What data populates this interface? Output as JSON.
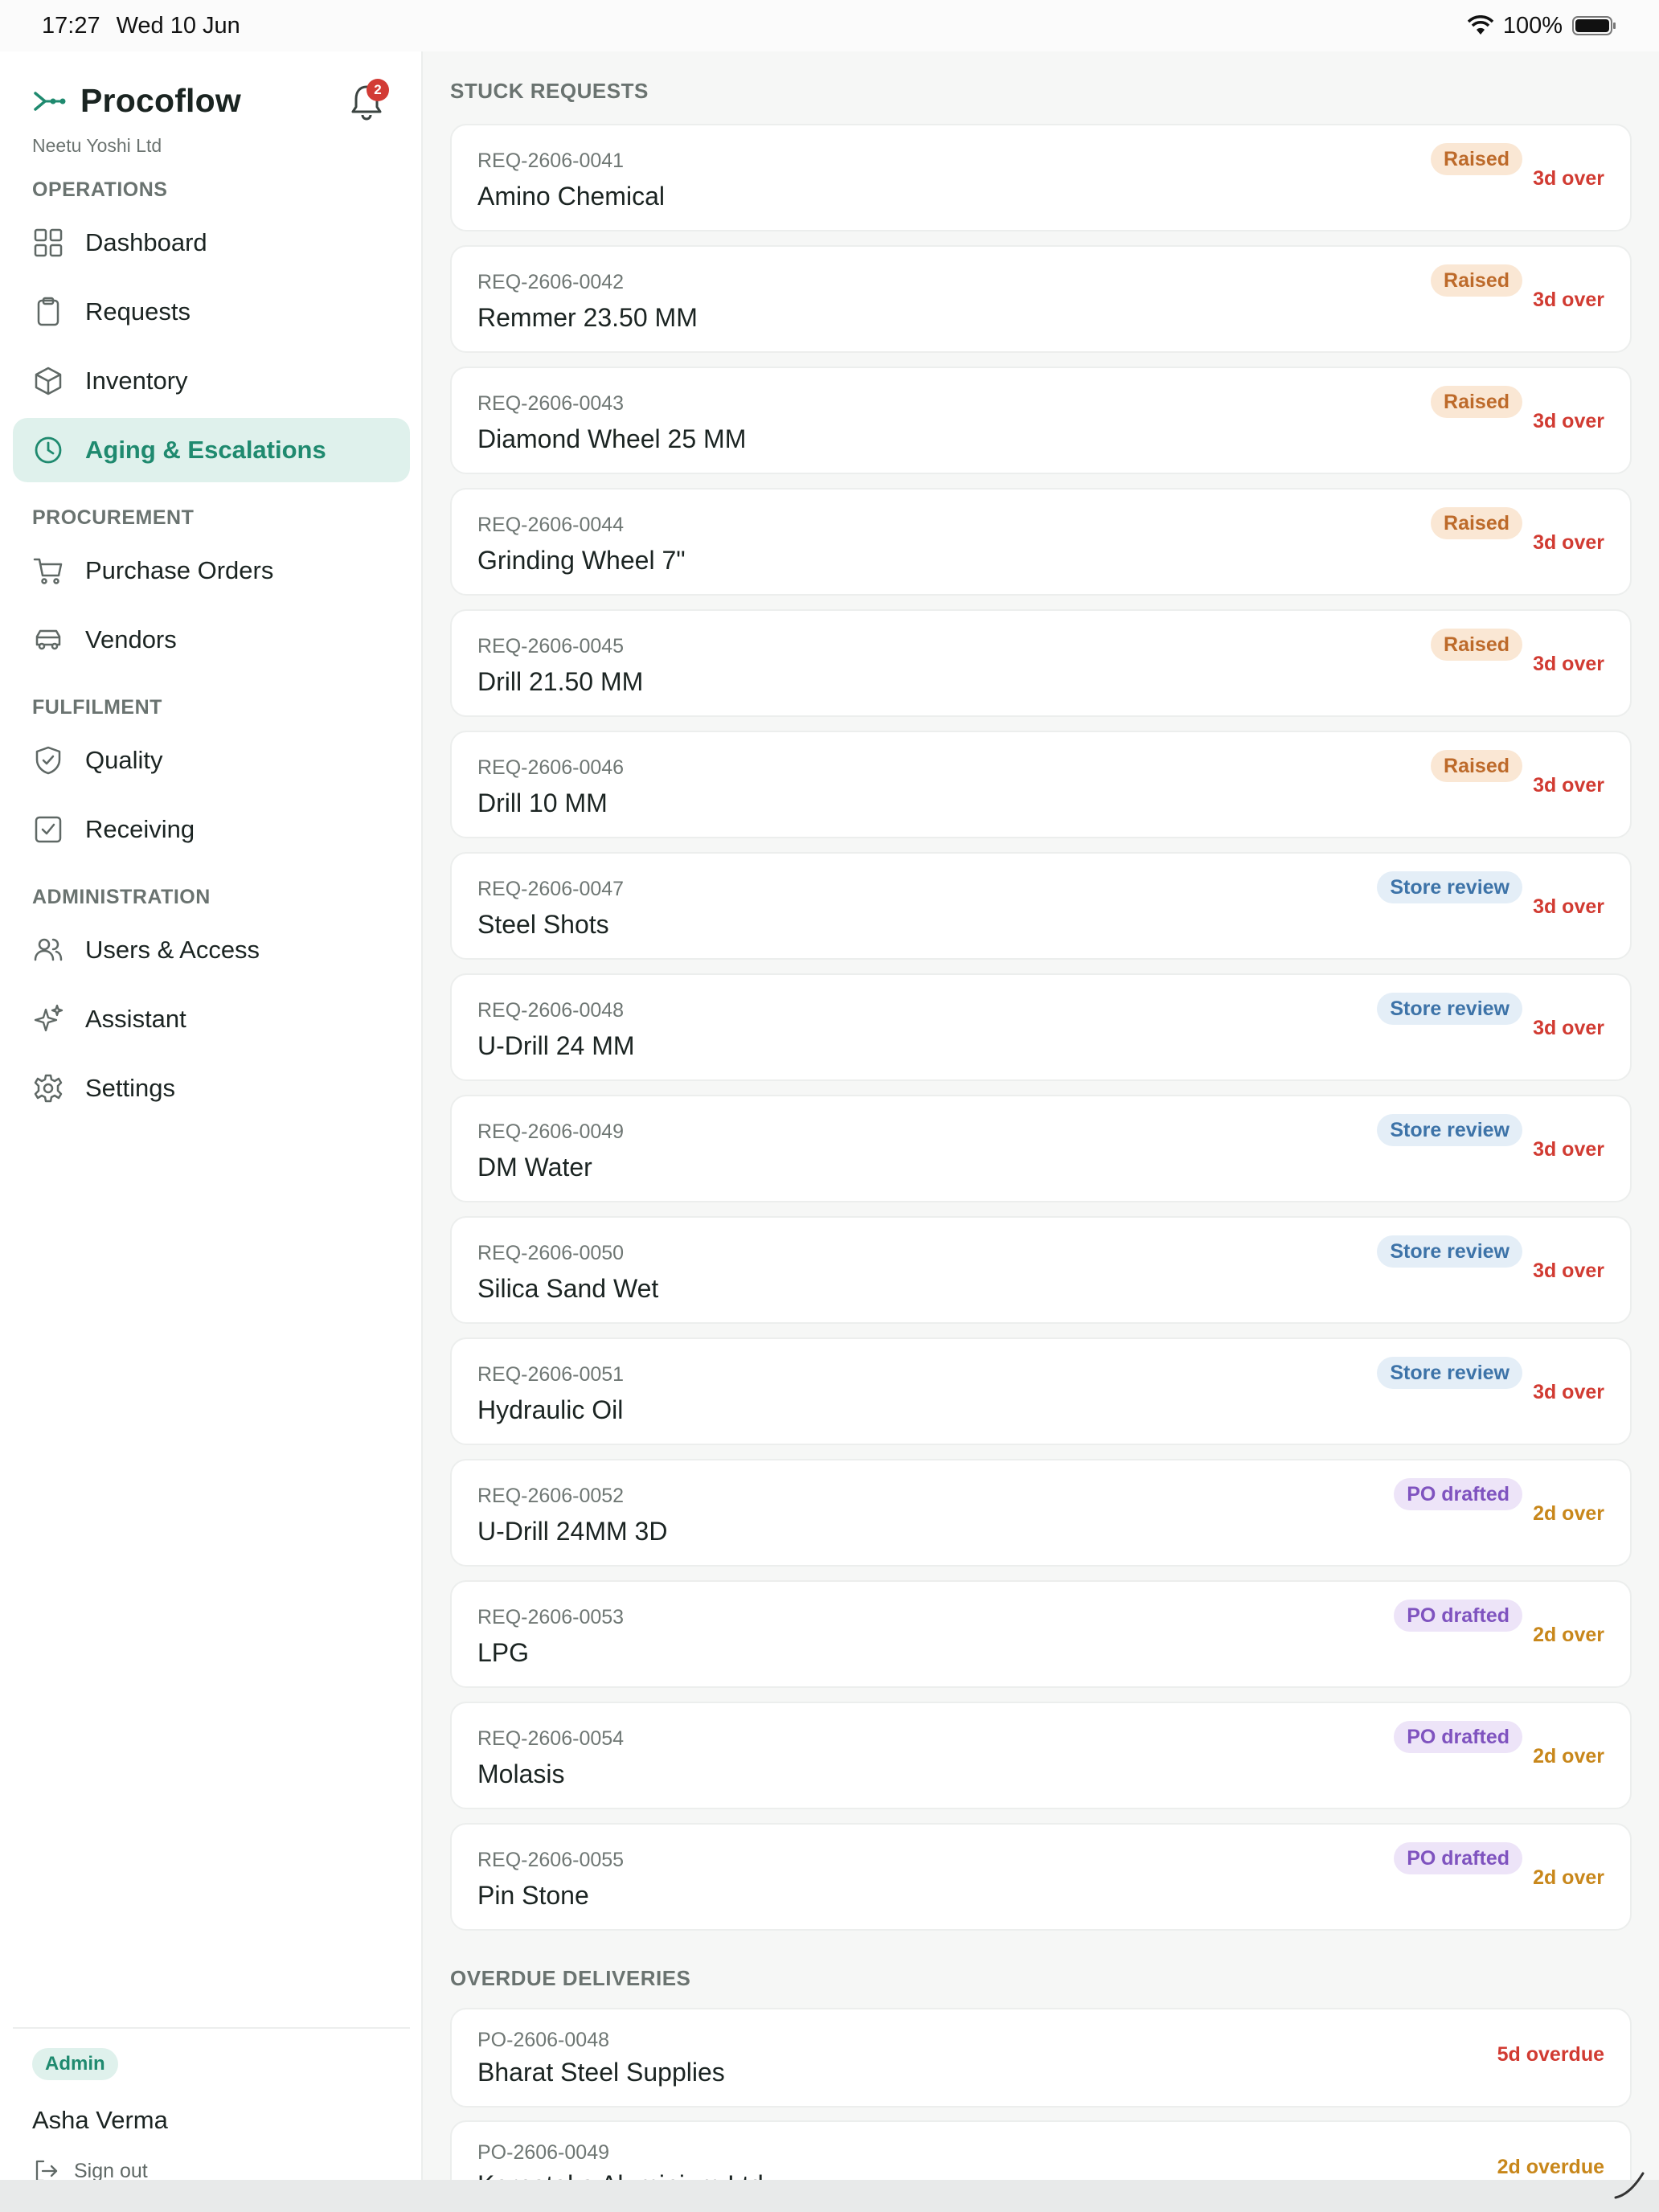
{
  "status_bar": {
    "time": "17:27",
    "date": "Wed 10 Jun",
    "battery": "100%"
  },
  "sidebar": {
    "app_name": "Procoflow",
    "org_name": "Neetu Yoshi Ltd",
    "notification_count": "2",
    "sections": [
      {
        "label": "OPERATIONS",
        "items": [
          {
            "label": "Dashboard",
            "icon": "grid-icon"
          },
          {
            "label": "Requests",
            "icon": "clipboard-icon"
          },
          {
            "label": "Inventory",
            "icon": "box-icon"
          },
          {
            "label": "Aging & Escalations",
            "icon": "clock-icon",
            "active": true
          }
        ]
      },
      {
        "label": "PROCUREMENT",
        "items": [
          {
            "label": "Purchase Orders",
            "icon": "cart-icon"
          },
          {
            "label": "Vendors",
            "icon": "truck-icon"
          }
        ]
      },
      {
        "label": "FULFILMENT",
        "items": [
          {
            "label": "Quality",
            "icon": "shield-check-icon"
          },
          {
            "label": "Receiving",
            "icon": "checkbox-icon"
          }
        ]
      },
      {
        "label": "ADMINISTRATION",
        "items": [
          {
            "label": "Users & Access",
            "icon": "users-icon"
          },
          {
            "label": "Assistant",
            "icon": "sparkle-icon"
          },
          {
            "label": "Settings",
            "icon": "gear-icon"
          }
        ]
      }
    ],
    "user": {
      "role": "Admin",
      "name": "Asha Verma",
      "sign_out": "Sign out"
    }
  },
  "main": {
    "stuck_heading": "STUCK REQUESTS",
    "stuck_requests": [
      {
        "id": "REQ-2606-0041",
        "name": "Amino Chemical",
        "status": "Raised",
        "overdue": "3d over"
      },
      {
        "id": "REQ-2606-0042",
        "name": "Remmer 23.50 MM",
        "status": "Raised",
        "overdue": "3d over"
      },
      {
        "id": "REQ-2606-0043",
        "name": "Diamond Wheel 25 MM",
        "status": "Raised",
        "overdue": "3d over"
      },
      {
        "id": "REQ-2606-0044",
        "name": "Grinding Wheel 7\"",
        "status": "Raised",
        "overdue": "3d over"
      },
      {
        "id": "REQ-2606-0045",
        "name": "Drill 21.50 MM",
        "status": "Raised",
        "overdue": "3d over"
      },
      {
        "id": "REQ-2606-0046",
        "name": "Drill 10 MM",
        "status": "Raised",
        "overdue": "3d over"
      },
      {
        "id": "REQ-2606-0047",
        "name": "Steel Shots",
        "status": "Store review",
        "overdue": "3d over"
      },
      {
        "id": "REQ-2606-0048",
        "name": "U-Drill 24 MM",
        "status": "Store review",
        "overdue": "3d over"
      },
      {
        "id": "REQ-2606-0049",
        "name": "DM Water",
        "status": "Store review",
        "overdue": "3d over"
      },
      {
        "id": "REQ-2606-0050",
        "name": "Silica Sand Wet",
        "status": "Store review",
        "overdue": "3d over"
      },
      {
        "id": "REQ-2606-0051",
        "name": "Hydraulic Oil",
        "status": "Store review",
        "overdue": "3d over"
      },
      {
        "id": "REQ-2606-0052",
        "name": "U-Drill 24MM 3D",
        "status": "PO drafted",
        "overdue": "2d over"
      },
      {
        "id": "REQ-2606-0053",
        "name": "LPG",
        "status": "PO drafted",
        "overdue": "2d over"
      },
      {
        "id": "REQ-2606-0054",
        "name": "Molasis",
        "status": "PO drafted",
        "overdue": "2d over"
      },
      {
        "id": "REQ-2606-0055",
        "name": "Pin Stone",
        "status": "PO drafted",
        "overdue": "2d over"
      }
    ],
    "deliveries_heading": "OVERDUE DELIVERIES",
    "overdue_deliveries": [
      {
        "id": "PO-2606-0048",
        "name": "Bharat Steel Supplies",
        "overdue": "5d overdue"
      },
      {
        "id": "PO-2606-0049",
        "name": "Karnataka Aluminium Ltd",
        "overdue": "2d overdue"
      }
    ]
  },
  "colors": {
    "accent": "#1f8a6f",
    "overdue_red": "#d13b32",
    "overdue_amber": "#c8871b",
    "raised": "#bd6a2a",
    "store_review": "#3d73a8",
    "po_drafted": "#7f53bf"
  }
}
